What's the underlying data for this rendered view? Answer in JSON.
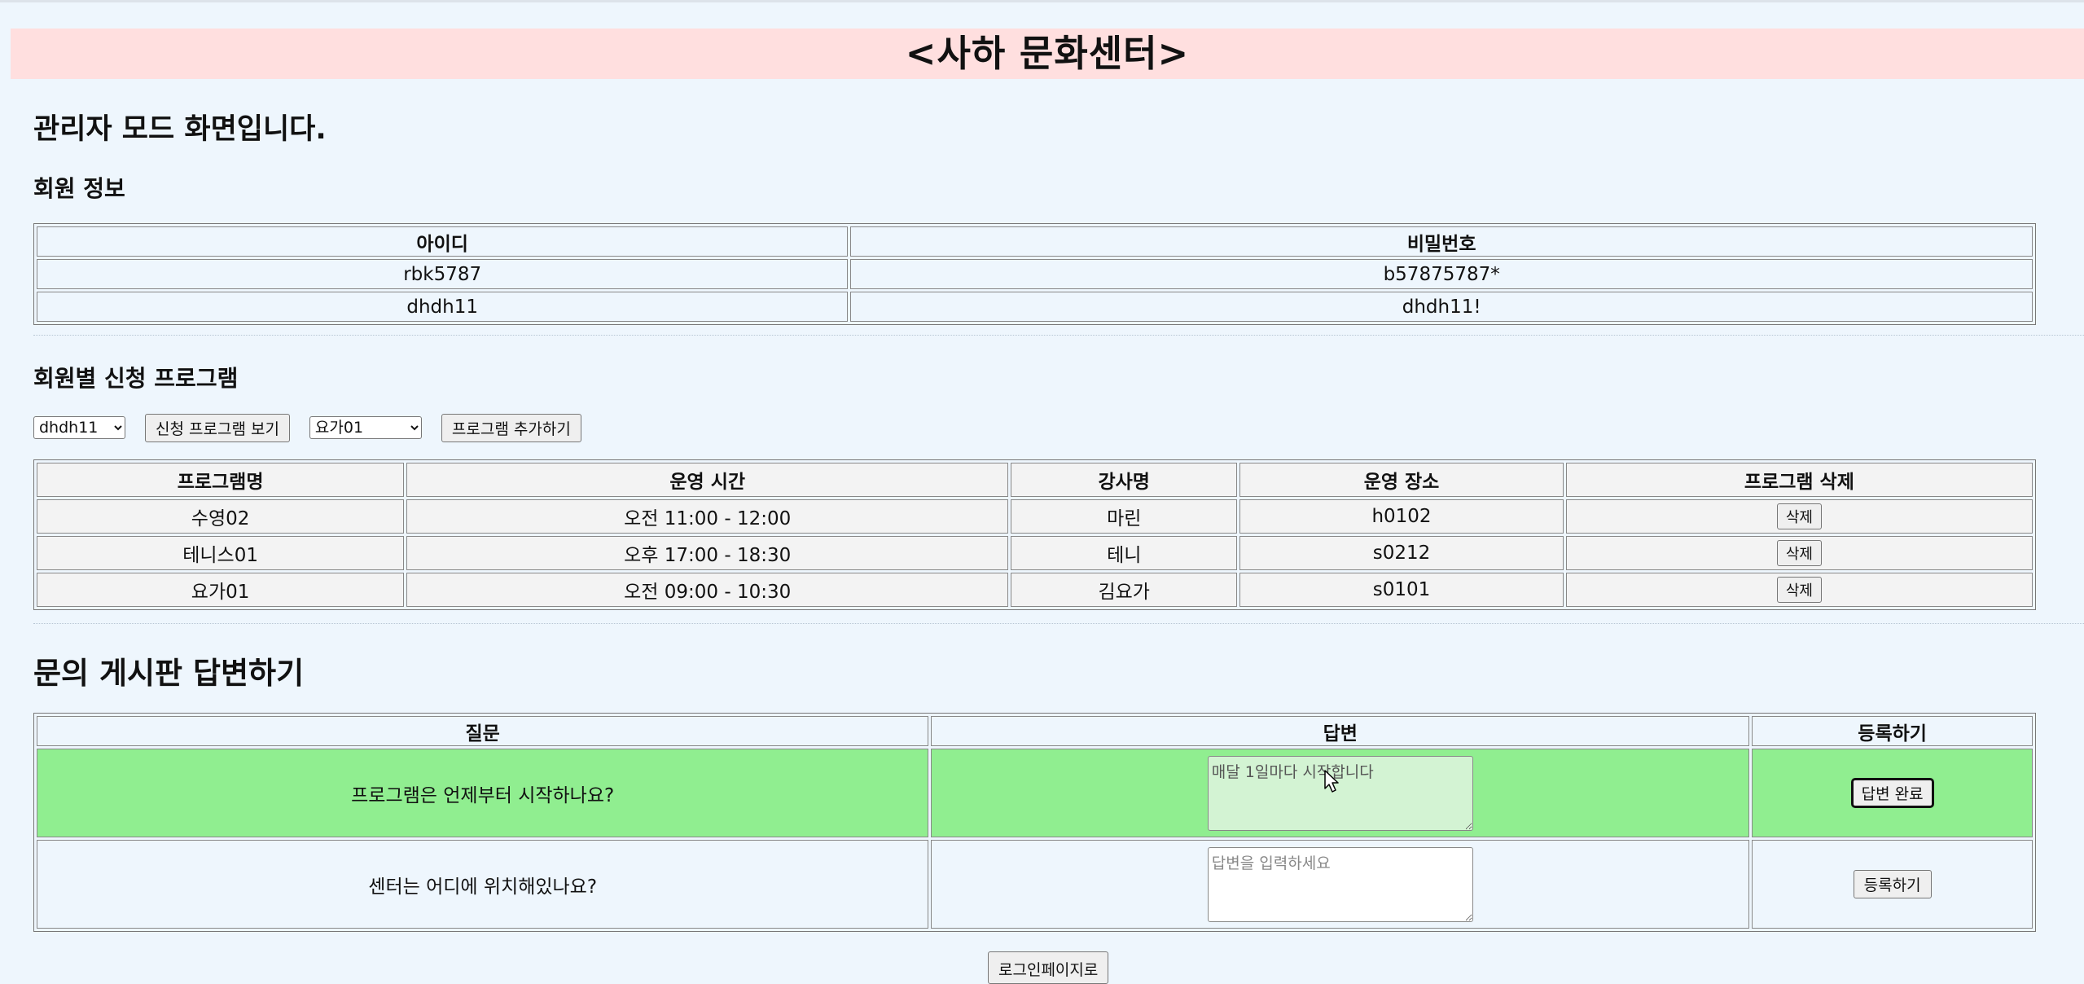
{
  "page": {
    "banner_title": "<사하 문화센터>",
    "admin_heading": "관리자 모드 화면입니다."
  },
  "members": {
    "heading": "회원 정보",
    "columns": [
      "아이디",
      "비밀번호"
    ],
    "rows": [
      [
        "rbk5787",
        "b57875787*"
      ],
      [
        "dhdh11",
        "dhdh11!"
      ]
    ]
  },
  "programs": {
    "heading": "회원별 신청 프로그램",
    "member_select_value": "dhdh11",
    "view_button": "신청 프로그램 보기",
    "program_select_value": "요가01",
    "add_button": "프로그램 추가하기",
    "columns": [
      "프로그램명",
      "운영 시간",
      "강사명",
      "운영 장소",
      "프로그램 삭제"
    ],
    "rows": [
      {
        "name": "수영02",
        "time": "오전 11:00 - 12:00",
        "instructor": "마린",
        "place": "h0102",
        "delete": "삭제"
      },
      {
        "name": "테니스01",
        "time": "오후 17:00 - 18:30",
        "instructor": "테니",
        "place": "s0212",
        "delete": "삭제"
      },
      {
        "name": "요가01",
        "time": "오전 09:00 - 10:30",
        "instructor": "김요가",
        "place": "s0101",
        "delete": "삭제"
      }
    ]
  },
  "qna": {
    "heading": "문의 게시판 답변하기",
    "columns": [
      "질문",
      "답변",
      "등록하기"
    ],
    "rows": [
      {
        "question": "프로그램은 언제부터 시작하나요?",
        "answer_value": "매달 1일마다 시작합니다",
        "answer_placeholder": "",
        "button": "답변 완료"
      },
      {
        "question": "센터는 어디에 위치해있나요?",
        "answer_value": "",
        "answer_placeholder": "답변을 입력하세요",
        "button": "등록하기"
      }
    ]
  },
  "footer": {
    "login_button": "로그인페이지로"
  },
  "colors": {
    "page_bg": "#eef6fd",
    "banner_bg": "#ffdfdf",
    "answered_row_bg": "#90ee90"
  }
}
